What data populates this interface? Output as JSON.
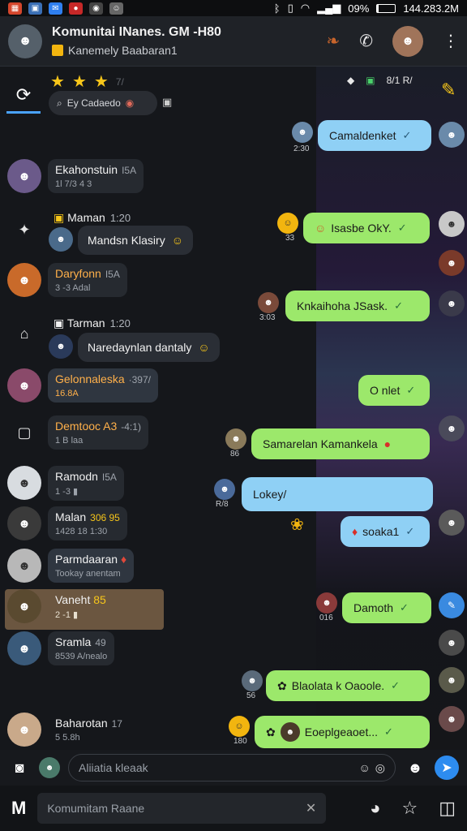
{
  "status_bar": {
    "apps": [
      {
        "icon": "gallery-icon",
        "color": "#d4462c"
      },
      {
        "icon": "photo-icon",
        "color": "#3a6fb5"
      },
      {
        "icon": "messenger-icon",
        "color": "#2f7ff0"
      },
      {
        "icon": "record-icon",
        "color": "#c62828"
      },
      {
        "icon": "game-icon",
        "color": "#444"
      },
      {
        "icon": "ghost-icon",
        "color": "#666"
      }
    ],
    "battery_text": "09%",
    "battery_level": 0.09,
    "clock": "144.283.2M"
  },
  "header": {
    "title": "Komunitai INanes. GM",
    "title_suffix": "-H80",
    "subtitle": "Kanemely Baabaran1",
    "avatar_color": "#55606a",
    "right_avatar_color": "#a0745a"
  },
  "left_panel": {
    "tab_icon": "refresh-icon",
    "stars": [
      "★",
      "★",
      "★"
    ],
    "stars_extra": "7/",
    "search_label": "Ey Cadaedo",
    "mini_icons": [
      "▣",
      "ƨ"
    ],
    "conversations": [
      {
        "name": "Ekahonstuin",
        "time": "I5A",
        "meta": "1l 7/3 4 3",
        "avatar": "#6b5a8a",
        "orange": false
      },
      {
        "name": "Daryfonn",
        "time": "I5A",
        "meta": "3 -3 Adal",
        "avatar": "#c96a2a",
        "orange": true
      },
      {
        "name": "Gelonnaleska",
        "time": "·397/",
        "meta": "16.8A",
        "avatar": "#8a4a6a",
        "orange": true
      },
      {
        "name": "Demtooc A3",
        "time": "-4:1)",
        "meta": "1 B laa",
        "avatar": "",
        "orange": true
      },
      {
        "name": "Ramodn",
        "time": "I5A",
        "meta": "1 -3 ▮",
        "avatar": "#d8dce0",
        "orange": false
      },
      {
        "name": "Malan",
        "time": "306 95",
        "meta": "1428 18 1:30",
        "avatar": "#3a3a3a",
        "orange": false
      },
      {
        "name": "Parmdaaran",
        "time": "",
        "meta": "Tookay anentam",
        "avatar": "#b8b8b8",
        "orange": false
      },
      {
        "name": "Vaneht",
        "time": "85",
        "meta": "2 -1  ▮",
        "avatar": "#5a4a30",
        "orange": false
      },
      {
        "name": "Sramla",
        "time": "49",
        "meta": "8539 A/nealo",
        "avatar": "#3a5a7a",
        "orange": false
      },
      {
        "name": "Baharotan",
        "time": "17",
        "meta": "5 5.8h",
        "avatar": "#c9a98a",
        "orange": false
      }
    ],
    "incoming": [
      {
        "sender": "Maman",
        "time": "1:20",
        "text": "Mandsn Klasiry"
      },
      {
        "sender": "Tarman",
        "time": "1:20",
        "text": "Naredaynlan dantaly"
      }
    ]
  },
  "chat": {
    "top_time": "8/1 R/",
    "messages": [
      {
        "text": "Camaldenket",
        "style": "blue",
        "time": "2:30"
      },
      {
        "text": "Isasbe OkY.",
        "style": "green",
        "time": "33"
      },
      {
        "text": "Knkaihoha JSask.",
        "style": "green",
        "time": "3:03"
      },
      {
        "text": "O nlet",
        "style": "green",
        "time": ""
      },
      {
        "text": "Samarelan Kamankela",
        "style": "green",
        "time": "86"
      },
      {
        "text": "Lokey/",
        "style": "blue",
        "time": "R/8"
      },
      {
        "text": "soaka1",
        "style": "blue",
        "time": ""
      },
      {
        "text": "Damoth",
        "style": "green",
        "time": "016"
      },
      {
        "text": "Blaolata k Oaoole.",
        "style": "green",
        "time": "56"
      },
      {
        "text": "Eoeplgeaoet...",
        "style": "green",
        "time": "180"
      }
    ]
  },
  "composer": {
    "placeholder": "Aliiatia kleaak"
  },
  "bottom_bar": {
    "search_text": "Komumitam Raane"
  }
}
